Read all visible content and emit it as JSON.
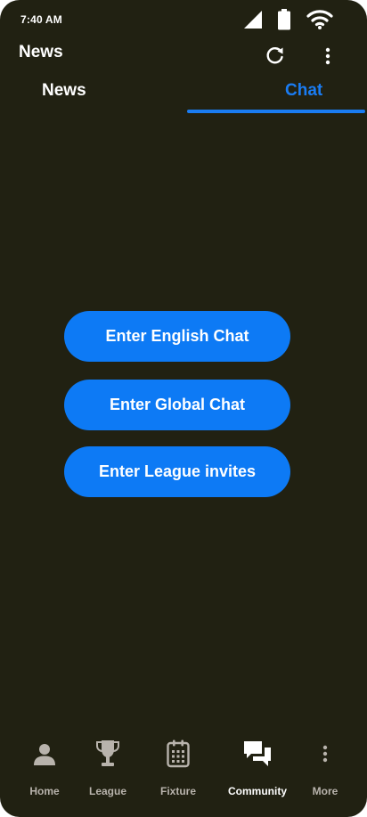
{
  "status_bar": {
    "time": "7:40 AM",
    "icons": [
      "signal-icon",
      "battery-icon",
      "wifi-icon"
    ]
  },
  "app_bar": {
    "title": "News",
    "actions": [
      "refresh-icon",
      "more-vert-icon"
    ]
  },
  "tabs": [
    {
      "label": "News",
      "selected": false
    },
    {
      "label": "Chat",
      "selected": true
    }
  ],
  "buttons": {
    "english_chat": "Enter English Chat",
    "global_chat": "Enter Global Chat",
    "league_invites": "Enter League invites"
  },
  "bottom_nav": [
    {
      "label": "Home",
      "icon": "person-icon",
      "active": false
    },
    {
      "label": "League",
      "icon": "trophy-icon",
      "active": false
    },
    {
      "label": "Fixture",
      "icon": "calendar-icon",
      "active": false
    },
    {
      "label": "Community",
      "icon": "chat-bubbles-icon",
      "active": true
    },
    {
      "label": "More",
      "icon": "more-vert-icon",
      "active": false
    }
  ],
  "colors": {
    "background": "#212112",
    "accent": "#1a7cf2",
    "button": "#0d7af5",
    "inactive_label": "#b8b3ac"
  }
}
